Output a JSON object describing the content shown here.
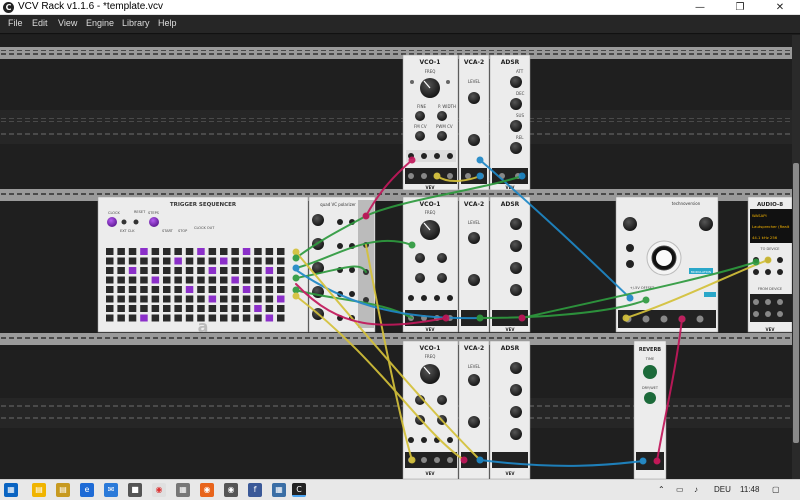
{
  "window": {
    "title": "VCV Rack v1.1.6 - *template.vcv",
    "app_icon": "C"
  },
  "menu": {
    "items": [
      "File",
      "Edit",
      "View",
      "Engine",
      "Library",
      "Help"
    ]
  },
  "modules": {
    "vco_top": {
      "title": "VCO-1",
      "freq": "FREQ",
      "fine": "FINE",
      "pw": "P. WIDTH",
      "fmcv": "FM CV",
      "pwmcv": "PWM CV",
      "brand": "VEV"
    },
    "vca_top": {
      "title": "VCA-2",
      "level": "LEVEL"
    },
    "adsr_top": {
      "title": "ADSR",
      "att": "ATT",
      "dec": "DEC",
      "sus": "SUS",
      "rel": "REL",
      "brand": "VEV"
    },
    "vco_mid": {
      "title": "VCO-1",
      "freq": "FREQ",
      "brand": "VEV"
    },
    "vca_mid": {
      "title": "VCA-2",
      "level": "LEVEL"
    },
    "adsr_mid": {
      "title": "ADSR",
      "brand": "VEV"
    },
    "vco_bot": {
      "title": "VCO-1",
      "freq": "FREQ",
      "brand": "VEV"
    },
    "vca_bot": {
      "title": "VCA-2",
      "level": "LEVEL"
    },
    "adsr_bot": {
      "title": "ADSR",
      "brand": "VEV"
    },
    "trigger_seq": {
      "title": "TRIGGER SEQUENCER",
      "clock": "CLOCK",
      "reset": "RESET",
      "steps": "STEPS",
      "start": "START",
      "stop": "STOP",
      "ext_clk": "EXT CLK",
      "clock_out": "CLOCK OUT",
      "logo": "a"
    },
    "quantizer": {
      "title": "quad VC polarizer"
    },
    "mixer": {
      "title": "technoversion",
      "env_offset": "+/-5V OFFSET",
      "badge": "MODULATION"
    },
    "audio": {
      "title": "AUDIO-8",
      "line1": "WASAPI",
      "line2": "Lautsprecher (Realt",
      "line3": "44.1 kHz  256",
      "to_device": "TO DEVICE",
      "from_device": "FROM DEVICE",
      "brand": "VEV"
    },
    "reverb": {
      "title": "REVERB",
      "time": "TIME",
      "dry_wet": "DRY/WET"
    }
  },
  "taskbar": {
    "language": "DEU",
    "time": "11:48"
  },
  "colors": {
    "rack_rail": "#8f8f8f",
    "module_bg": "#ececec",
    "purple": "#8b2fc9",
    "dark_panel": "#222222"
  }
}
